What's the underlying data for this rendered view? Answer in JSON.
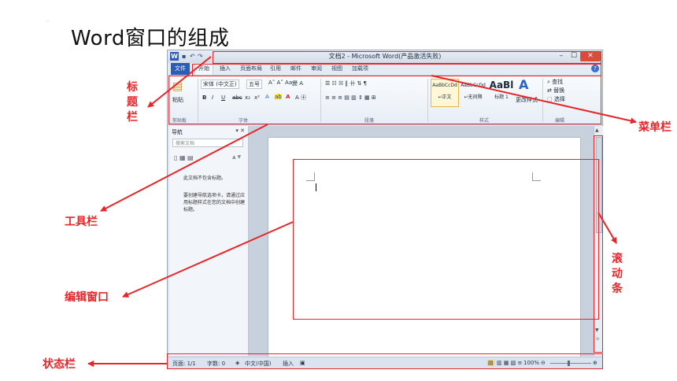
{
  "slide": {
    "title": "Word窗口的组成",
    "dot": "."
  },
  "window": {
    "title": "文档2 - Microsoft Word(产品激活失败)",
    "app_icon": "W",
    "controls": {
      "min": "–",
      "max": "☐",
      "close": "✕"
    }
  },
  "tabs": [
    {
      "label": "文件"
    },
    {
      "label": "开始"
    },
    {
      "label": "插入"
    },
    {
      "label": "页面布局"
    },
    {
      "label": "引用"
    },
    {
      "label": "邮件"
    },
    {
      "label": "审阅"
    },
    {
      "label": "视图"
    },
    {
      "label": "加载项"
    }
  ],
  "ribbon": {
    "clipboard": {
      "paste": "粘贴",
      "group": "剪贴板"
    },
    "font": {
      "name": "宋体 (中文正)",
      "size": "五号",
      "bold": "B",
      "italic": "I",
      "underline": "U",
      "strike": "abc",
      "sub": "x₂",
      "sup": "x²",
      "group": "字体"
    },
    "paragraph": {
      "group": "段落"
    },
    "styles": {
      "items": [
        {
          "preview": "AaBbCcDd",
          "name": "↵正文"
        },
        {
          "preview": "AaBbCcDd",
          "name": "↵无间隔"
        },
        {
          "preview": "AaBl",
          "name": "标题 1"
        }
      ],
      "change": "更改样式",
      "group": "样式"
    },
    "editing": {
      "find": "查找",
      "replace": "替换",
      "select": "选择",
      "group": "编辑"
    }
  },
  "nav": {
    "title": "导航",
    "search_placeholder": "搜索文档",
    "msg1": "此文档不包含标题。",
    "msg2": "要创建导航选项卡，请通过应用标题样式在您的文档中创建标题。"
  },
  "status": {
    "page": "页面: 1/1",
    "words": "字数: 0",
    "lang": "中文(中国)",
    "mode": "插入",
    "zoom": "100%"
  },
  "annotations": {
    "title_bar": "标题栏",
    "menu_bar": "菜单栏",
    "toolbar": "工具栏",
    "edit_window": "编辑窗口",
    "scroll_bar": "滚动条",
    "status_bar": "状态栏"
  },
  "colors": {
    "annotation": "#e8262a",
    "file_tab": "#2b5cb8",
    "close_button": "#d94b3a"
  }
}
